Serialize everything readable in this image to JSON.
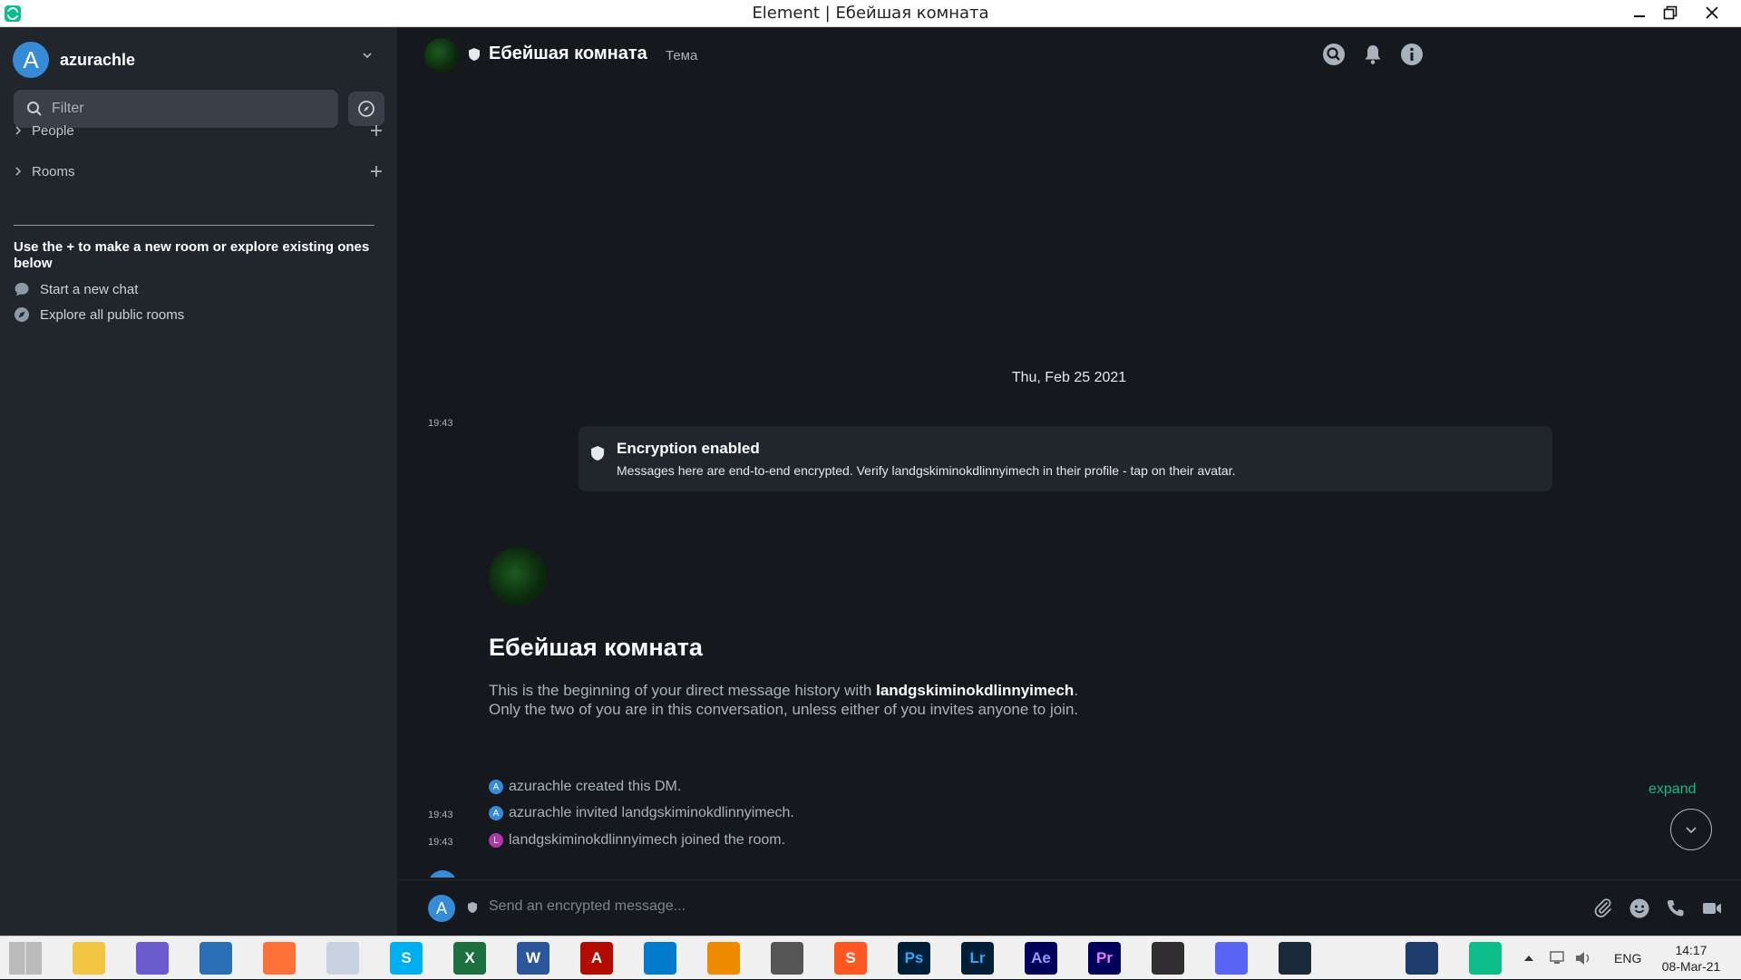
{
  "window": {
    "title": "Element | Ебейшая комната"
  },
  "sidebar": {
    "account": {
      "avatar_letter": "A",
      "name": "azurachle"
    },
    "filter_placeholder": "Filter",
    "sections": [
      {
        "label": "People"
      },
      {
        "label": "Rooms"
      }
    ],
    "hint": "Use the + to make a new room or explore existing ones below",
    "links": [
      {
        "label": "Start a new chat",
        "icon": "chat-bubble-icon"
      },
      {
        "label": "Explore all public rooms",
        "icon": "compass-icon"
      }
    ]
  },
  "room": {
    "name": "Ебейшая комната",
    "topic": "Тема",
    "header_icons": [
      "search-icon",
      "bell-icon",
      "info-icon"
    ]
  },
  "timeline": {
    "date": "Thu, Feb 25 2021",
    "encryption": {
      "time": "19:43",
      "title": "Encryption enabled",
      "description": "Messages here are end-to-end encrypted. Verify landgskiminokdlinnyimech in their profile - tap on their avatar."
    },
    "intro": {
      "title": "Ебейшая комната",
      "line1_prefix": "This is the beginning of your direct message history with ",
      "line1_name": "landgskiminokdlinnyimech",
      "line1_suffix": ".",
      "line2": "Only the two of you are in this conversation, unless either of you invites anyone to join."
    },
    "events": [
      {
        "time": "",
        "avatar_letter": "A",
        "avatar_color": "#368bd6",
        "text": "azurachle created this DM."
      },
      {
        "time": "19:43",
        "avatar_letter": "A",
        "avatar_color": "#368bd6",
        "text": "azurachle invited landgskiminokdlinnyimech."
      },
      {
        "time": "19:43",
        "avatar_letter": "L",
        "avatar_color": "#ac3ba8",
        "text": "landgskiminokdlinnyimech joined the room."
      }
    ],
    "expand_label": "expand"
  },
  "composer": {
    "avatar_letter": "A",
    "placeholder": "Send an encrypted message...",
    "icons": [
      "paperclip-icon",
      "emoji-icon",
      "phone-icon",
      "video-icon"
    ]
  },
  "taskbar": {
    "apps": [
      {
        "name": "windows-start-icon",
        "label": "",
        "bg": "#f0f0f0",
        "fg": "#0078d7"
      },
      {
        "name": "file-explorer-icon",
        "label": "",
        "bg": "#f4c542",
        "fg": "#b58500"
      },
      {
        "name": "qbittorrent-icon",
        "label": "",
        "bg": "#6a5acd",
        "fg": "#fff"
      },
      {
        "name": "browser-globe-icon",
        "label": "",
        "bg": "#2a6fb5",
        "fg": "#fff"
      },
      {
        "name": "firefox-icon",
        "label": "",
        "bg": "#ff7139",
        "fg": "#fff"
      },
      {
        "name": "moon-app-icon",
        "label": "",
        "bg": "#c8d2e0",
        "fg": "#fff"
      },
      {
        "name": "skype-icon",
        "label": "S",
        "bg": "#00aff0",
        "fg": "#fff"
      },
      {
        "name": "excel-icon",
        "label": "X",
        "bg": "#1d6f42",
        "fg": "#fff"
      },
      {
        "name": "word-icon",
        "label": "W",
        "bg": "#2b579a",
        "fg": "#fff"
      },
      {
        "name": "acrobat-icon",
        "label": "A",
        "bg": "#b30b00",
        "fg": "#fff"
      },
      {
        "name": "vscode-icon",
        "label": "",
        "bg": "#007acc",
        "fg": "#fff"
      },
      {
        "name": "vlc-icon",
        "label": "",
        "bg": "#f08a00",
        "fg": "#fff"
      },
      {
        "name": "download-icon",
        "label": "",
        "bg": "#555",
        "fg": "#fff"
      },
      {
        "name": "sublime-icon",
        "label": "S",
        "bg": "#ff5722",
        "fg": "#fff"
      },
      {
        "name": "photoshop-icon",
        "label": "Ps",
        "bg": "#001e36",
        "fg": "#31a8ff"
      },
      {
        "name": "lightroom-icon",
        "label": "Lr",
        "bg": "#001e36",
        "fg": "#31a8ff"
      },
      {
        "name": "after-effects-icon",
        "label": "Ae",
        "bg": "#00005b",
        "fg": "#9999ff"
      },
      {
        "name": "premiere-icon",
        "label": "Pr",
        "bg": "#00005b",
        "fg": "#ea77ff"
      },
      {
        "name": "obs-icon",
        "label": "",
        "bg": "#302e31",
        "fg": "#fff"
      },
      {
        "name": "discord-icon",
        "label": "",
        "bg": "#5865f2",
        "fg": "#fff"
      },
      {
        "name": "steam-icon",
        "label": "",
        "bg": "#1b2838",
        "fg": "#fff"
      },
      {
        "name": "opera-icon",
        "label": "",
        "bg": "#f0f0f0",
        "fg": "#9b1cff"
      },
      {
        "name": "vpn-lock-icon",
        "label": "",
        "bg": "#1d3c6e",
        "fg": "#fff"
      },
      {
        "name": "element-icon",
        "label": "",
        "bg": "#0dbd8b",
        "fg": "#fff"
      }
    ],
    "lang": "ENG",
    "time": "14:17",
    "date": "08-Mar-21"
  }
}
